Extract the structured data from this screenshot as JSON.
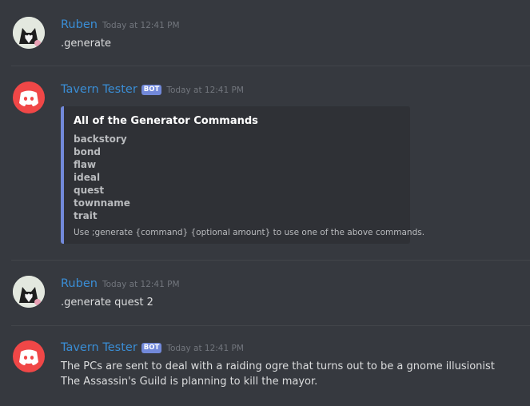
{
  "messages": [
    {
      "username": "Ruben",
      "timestamp": "Today at 12:41 PM",
      "content": ".generate"
    },
    {
      "username": "Tavern Tester",
      "bot_tag": "BOT",
      "timestamp": "Today at 12:41 PM",
      "embed": {
        "title": "All of the Generator Commands",
        "commands": [
          "backstory",
          "bond",
          "flaw",
          "ideal",
          "quest",
          "townname",
          "trait"
        ],
        "footer": "Use ;generate {command} {optional amount} to use one of the above commands."
      }
    },
    {
      "username": "Ruben",
      "timestamp": "Today at 12:41 PM",
      "content": ".generate quest 2"
    },
    {
      "username": "Tavern Tester",
      "bot_tag": "BOT",
      "timestamp": "Today at 12:41 PM",
      "lines": [
        "The PCs are sent to deal with a raiding ogre that turns out to be a gnome illusionist",
        "The Assassin's Guild is planning to kill the mayor."
      ]
    }
  ],
  "colors": {
    "background": "#36393f",
    "username": "#3a8ed6",
    "bot_tag": "#7289da",
    "embed_border": "#7289da",
    "bot_avatar": "#f04747"
  }
}
